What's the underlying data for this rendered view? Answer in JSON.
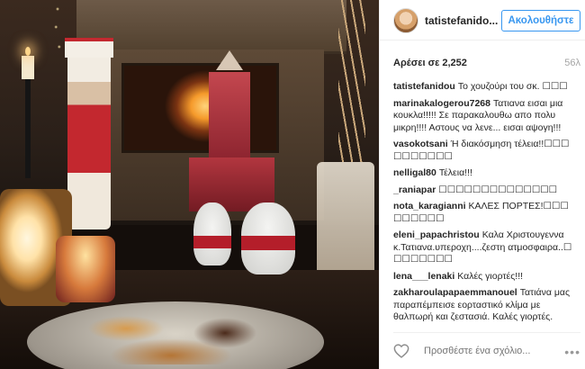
{
  "header": {
    "username": "tatistefanido...",
    "follow_label": "Ακολουθήστε"
  },
  "stats": {
    "likes": "Αρέσει σε 2,252",
    "time": "56λ"
  },
  "comments": [
    {
      "user": "tatistefanidou",
      "text": "Το χουζούρι του σκ. ☐☐☐"
    },
    {
      "user": "marinakalogerou7268",
      "text": "Τατιανα εισαι μια κουκλα!!!!! Σε παρακαλουθω απο πολυ μικρη!!!! Αστους να λενε... εισαι αψογη!!!"
    },
    {
      "user": "vasokotsani",
      "text": "Ή διακόσμηση τέλεια!!☐☐☐ ☐☐☐☐☐☐☐"
    },
    {
      "user": "nelligal80",
      "text": "Τέλεια!!!"
    },
    {
      "user": "_raniapar",
      "text": "☐☐☐☐☐☐☐☐☐☐☐☐☐☐"
    },
    {
      "user": "nota_karagianni",
      "text": "ΚΑΛΕΣ ΠΟΡΤΕΣ!☐☐☐ ☐☐☐☐☐☐"
    },
    {
      "user": "eleni_papachristou",
      "text": "Καλα Χριστουγεννα κ.Τατιανα.υπεροχη....ζεστη ατμοσφαιρα..☐ ☐☐☐☐☐☐☐"
    },
    {
      "user": "lena___lenaki",
      "text": "Καλές γιορτές!!!"
    },
    {
      "user": "zakharoulapapaemmanouel",
      "text": "Τατιάνα μας παραπέμπεισε εορταστικό κλίμα με θαλπωρή και ζεστασιά. Καλές γιορτές."
    }
  ],
  "footer": {
    "comment_placeholder": "Προσθέστε ένα σχόλιο...",
    "more_label": "•••"
  }
}
